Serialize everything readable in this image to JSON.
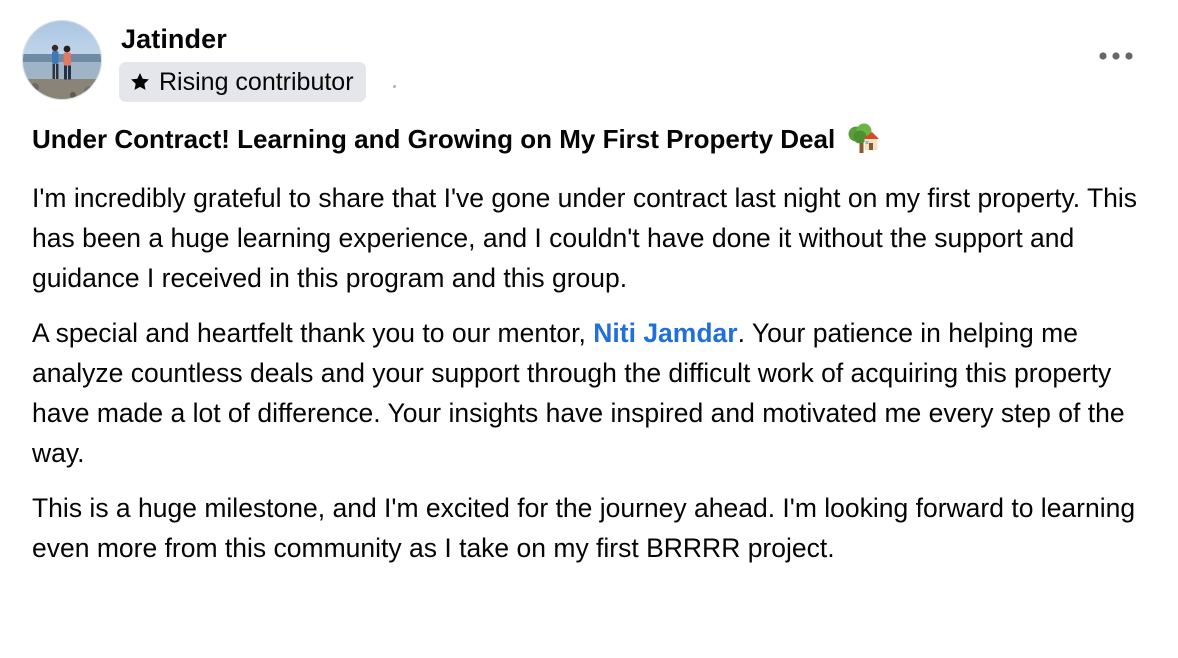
{
  "post": {
    "author": {
      "name": "Jatinder",
      "badge": "Rising contributor",
      "badge_icon": "star-icon"
    },
    "more_icon": "more-horizontal-icon",
    "title": "Under Contract! Learning and Growing on My First Property Deal",
    "title_emoji": "tree-house-emoji",
    "paragraphs": [
      {
        "text": "I'm incredibly grateful to share that I've gone under contract last night on my first property. This has been a huge learning experience, and I couldn't have done it without the support and guidance I received in this program and this group."
      },
      {
        "before": "A special and heartfelt thank you to our mentor, ",
        "mention": "Niti Jamdar",
        "after": ". Your patience in helping me analyze countless deals and your support through the difficult work of acquiring this property have made a lot of difference. Your insights have inspired and motivated me every step of the way."
      },
      {
        "text": "This is a huge milestone, and I'm excited for the journey ahead. I'm looking forward to learning even more from this community as I take on my first BRRRR project."
      }
    ]
  },
  "colors": {
    "text": "#050505",
    "mention": "#216fdb",
    "badge_bg": "#e4e6eb",
    "muted": "#65676b"
  }
}
